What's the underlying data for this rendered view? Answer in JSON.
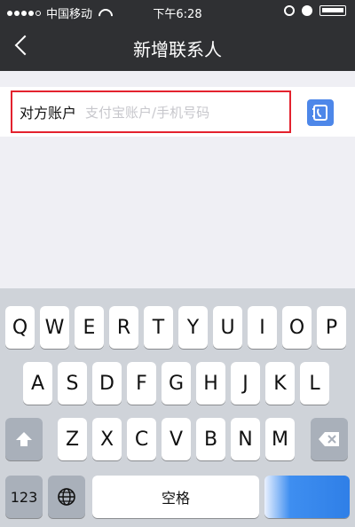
{
  "status_bar": {
    "carrier": "中国移动",
    "time": "下午6:28"
  },
  "nav": {
    "title": "新增联系人"
  },
  "form": {
    "label": "对方账户",
    "placeholder": "支付宝账户/手机号码"
  },
  "keyboard": {
    "row1": [
      "Q",
      "W",
      "E",
      "R",
      "T",
      "Y",
      "U",
      "I",
      "O",
      "P"
    ],
    "row2": [
      "A",
      "S",
      "D",
      "F",
      "G",
      "H",
      "J",
      "K",
      "L"
    ],
    "row3": [
      "Z",
      "X",
      "C",
      "V",
      "B",
      "N",
      "M"
    ],
    "num_key": "123",
    "space_key": "空格"
  },
  "colors": {
    "header_bg": "#2f3033",
    "highlight_border": "#e3222e",
    "contact_button": "#4d87e9"
  },
  "icons": {
    "back": "chevron-left-icon",
    "contact": "contact-book-icon",
    "shift": "shift-icon",
    "delete": "backspace-icon",
    "globe": "globe-icon"
  }
}
